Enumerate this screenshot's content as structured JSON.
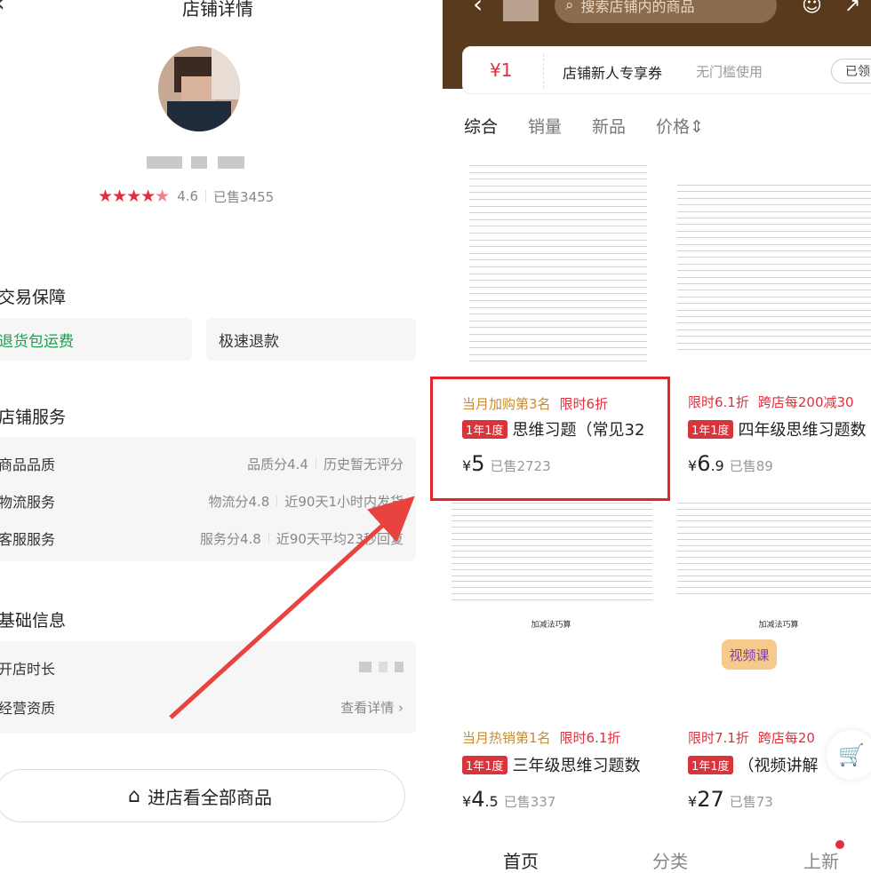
{
  "left": {
    "title": "店铺详情",
    "rating": {
      "stars": "★★★★",
      "half": "★",
      "score": "4.6",
      "sold": "已售3455"
    },
    "trade": {
      "title": "交易保障",
      "items": [
        "退货包运费",
        "极速退款"
      ]
    },
    "service": {
      "title": "店铺服务",
      "rows": [
        {
          "k": "商品品质",
          "v1": "品质分4.4",
          "v2": "历史暂无评分"
        },
        {
          "k": "物流服务",
          "v1": "物流分4.8",
          "v2": "近90天1小时内发货"
        },
        {
          "k": "客服服务",
          "v1": "服务分4.8",
          "v2": "近90天平均23秒回复"
        }
      ]
    },
    "basic": {
      "title": "基础信息",
      "rows": [
        {
          "k": "开店时长",
          "v": ""
        },
        {
          "k": "经营资质",
          "v": "查看详情 ›"
        }
      ]
    },
    "enter_button": "进店看全部商品"
  },
  "right": {
    "search_placeholder": "搜索店铺内的商品",
    "coupon": {
      "amount": "¥1",
      "name": "店铺新人专享券",
      "note": "无门槛使用",
      "button": "已领"
    },
    "sort_tabs": [
      "综合",
      "销量",
      "新品",
      "价格⇕"
    ],
    "products": [
      {
        "tag": "当月加购第3名",
        "sale": "限时6折",
        "badge": "1年1度",
        "title": "思维习题（常见32",
        "cur": "¥",
        "big": "5",
        "dec": "",
        "sold": "已售2723"
      },
      {
        "tag": "",
        "sale_prefix": "限时6.1折",
        "sale": "跨店每200减30",
        "badge": "1年1度",
        "title": "四年级思维习题数",
        "cur": "¥",
        "big": "6",
        "dec": ".9",
        "sold": "已售89"
      },
      {
        "tag": "当月热销第1名",
        "sale": "限时6.1折",
        "badge": "1年1度",
        "title": "三年级思维习题数",
        "cur": "¥",
        "big": "4",
        "dec": ".5",
        "sold": "已售337"
      },
      {
        "tag": "",
        "sale_prefix": "限时7.1折",
        "sale": "跨店每20",
        "badge": "1年1度",
        "title": "（视频讲解",
        "cur": "¥",
        "big": "27",
        "dec": "",
        "sold": "已售73"
      }
    ],
    "video_tag": "视频课",
    "doc_titles": [
      "加减法巧算",
      "加减法巧算"
    ],
    "bottom_nav": [
      "首页",
      "分类",
      "上新"
    ]
  },
  "colors": {
    "accent_red": "#e0303d",
    "brown_header": "#5a3a1c",
    "gold_tag": "#c78b32",
    "green": "#16a34a"
  }
}
